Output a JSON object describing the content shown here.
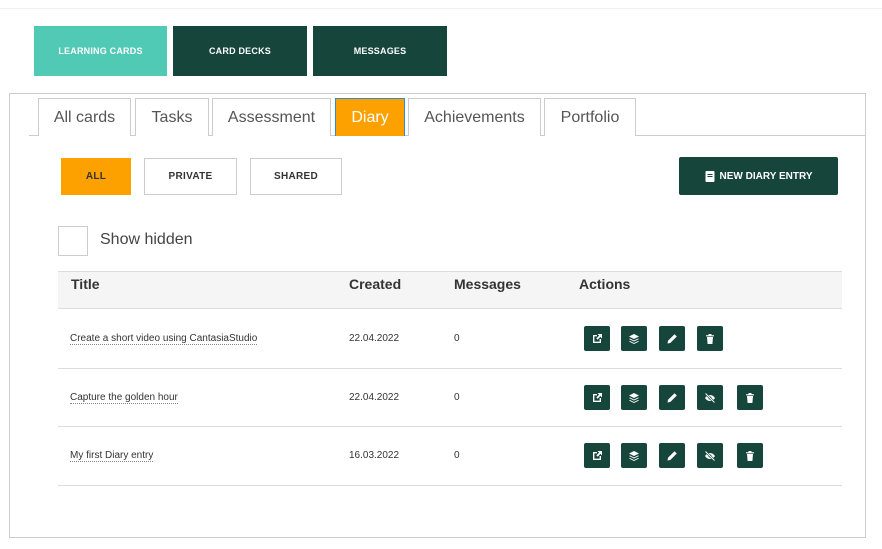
{
  "topnav": {
    "learning_cards": "LEARNING CARDS",
    "card_decks": "CARD DECKS",
    "messages": "MESSAGES",
    "active_color": "#50c9b5",
    "dark_color": "#15453b"
  },
  "tabs": [
    "All cards",
    "Tasks",
    "Assessment",
    "Diary",
    "Achievements",
    "Portfolio"
  ],
  "active_tab": "Diary",
  "filters": {
    "all": "ALL",
    "private": "PRIVATE",
    "shared": "SHARED",
    "active": "ALL"
  },
  "new_entry_label": "NEW DIARY ENTRY",
  "show_hidden": {
    "label": "Show hidden",
    "checked": false
  },
  "table": {
    "headers": {
      "title": "Title",
      "created": "Created",
      "messages": "Messages",
      "actions": "Actions"
    },
    "rows": [
      {
        "title": "Create a short video using CantasiaStudio",
        "created": "22.04.2022",
        "messages": "0",
        "actions": [
          "external-link-icon",
          "layers-icon",
          "pencil-icon",
          "trash-icon"
        ]
      },
      {
        "title": "Capture the golden hour",
        "created": "22.04.2022",
        "messages": "0",
        "actions": [
          "external-link-icon",
          "layers-icon",
          "pencil-icon",
          "eye-slash-icon",
          "trash-icon"
        ]
      },
      {
        "title": "My first Diary entry",
        "created": "16.03.2022",
        "messages": "0",
        "actions": [
          "external-link-icon",
          "layers-icon",
          "pencil-icon",
          "eye-slash-icon",
          "trash-icon"
        ]
      }
    ]
  },
  "colors": {
    "accent_orange": "#fca100",
    "dark_green": "#15453b",
    "teal": "#50c9b5"
  }
}
